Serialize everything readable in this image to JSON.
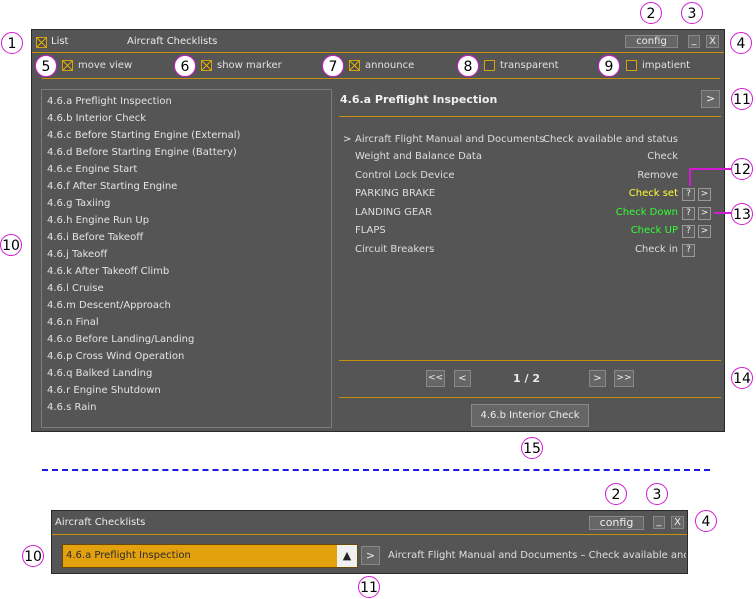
{
  "callouts": [
    "1",
    "2",
    "3",
    "4",
    "5",
    "6",
    "7",
    "8",
    "9",
    "10",
    "11",
    "12",
    "13",
    "14",
    "15"
  ],
  "top_window": {
    "list_label": "List",
    "title": "Aircraft Checklists",
    "config_label": "config",
    "minimize_label": "_",
    "close_label": "X",
    "options": [
      {
        "label": "move view",
        "checked": true
      },
      {
        "label": "show marker",
        "checked": true
      },
      {
        "label": "announce",
        "checked": true
      },
      {
        "label": "transparent",
        "checked": false
      },
      {
        "label": "impatient",
        "checked": false
      }
    ],
    "checklists": [
      "4.6.a Preflight Inspection",
      "4.6.b Interior Check",
      "4.6.c Before Starting Engine (External)",
      "4.6.d Before Starting Engine (Battery)",
      "4.6.e Engine Start",
      "4.6.f After Starting Engine",
      "4.6.g Taxiing",
      "4.6.h Engine Run Up",
      "4.6.i Before Takeoff",
      "4.6.j Takeoff",
      "4.6.k After Takeoff Climb",
      "4.6.l Cruise",
      "4.6.m Descent/Approach",
      "4.6.n Final",
      "4.6.o Before Landing/Landing",
      "4.6.p Cross Wind Operation",
      "4.6.q Balked Landing",
      "4.6.r Engine Shutdown",
      "4.6.s Rain"
    ],
    "current_title": "4.6.a Preflight Inspection",
    "next_arrow": ">",
    "marker": ">",
    "items": [
      {
        "label": "Aircraft Flight Manual and Documents",
        "value": "Check available and status",
        "color": "#dedede"
      },
      {
        "label": "Weight and Balance Data",
        "value": "Check",
        "color": "#dedede"
      },
      {
        "label": "Control Lock Device",
        "value": "Remove",
        "color": "#dedede"
      },
      {
        "label": "PARKING BRAKE",
        "value": "Check set",
        "color": "#ffff33"
      },
      {
        "label": "LANDING GEAR",
        "value": "Check Down",
        "color": "#33ff33"
      },
      {
        "label": "FLAPS",
        "value": "Check UP",
        "color": "#33ff33"
      },
      {
        "label": "Circuit Breakers",
        "value": "Check in",
        "color": "#dedede"
      }
    ],
    "help_label": "?",
    "go_label": ">",
    "pager": {
      "first": "<<",
      "prev": "<",
      "page": "1 / 2",
      "next": ">",
      "last": ">>"
    },
    "next_checklist": "4.6.b Interior Check"
  },
  "bottom_window": {
    "title": "Aircraft Checklists",
    "config_label": "config",
    "minimize_label": "_",
    "close_label": "X",
    "selected_checklist": "4.6.a Preflight Inspection",
    "dropdown_arrow": "▲",
    "next_arrow": ">",
    "current_item": "Aircraft Flight Manual and Documents –  Check available and"
  },
  "colors": {
    "accent": "#c58f0c",
    "window_bg": "#555555",
    "separator": "#1a1ae6",
    "callout_border": "#d21bd2"
  }
}
